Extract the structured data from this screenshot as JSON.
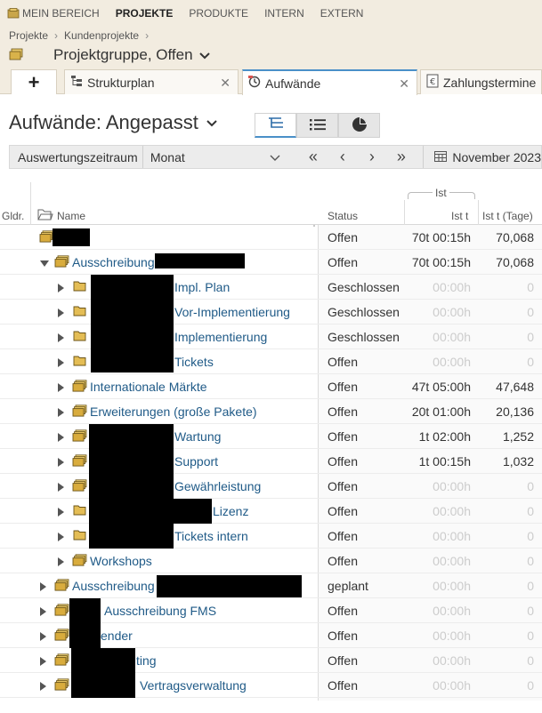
{
  "topnav": {
    "items": [
      {
        "label": "MEIN BEREICH",
        "active": false
      },
      {
        "label": "PROJEKTE",
        "active": true
      },
      {
        "label": "PRODUKTE",
        "active": false
      },
      {
        "label": "INTERN",
        "active": false
      },
      {
        "label": "EXTERN",
        "active": false
      }
    ]
  },
  "breadcrumb": [
    "Projekte",
    "Kundenprojekte"
  ],
  "project": {
    "title": "Projektgruppe, Offen"
  },
  "tabs": [
    {
      "label": "Strukturplan"
    },
    {
      "label": "Aufwände"
    },
    {
      "label": "Zahlungstermine"
    }
  ],
  "view": {
    "title": "Aufwände: Angepasst"
  },
  "filter": {
    "label": "Auswertungszeitraum",
    "select": "Monat",
    "period": "November 2023"
  },
  "table": {
    "headers": {
      "gldr": "Gldr.",
      "name": "Name",
      "status": "Status",
      "group": "Ist",
      "ist_t": "Ist t",
      "ist_tage": "Ist t (Tage)"
    },
    "rows": [
      {
        "name": "",
        "status": "Offen",
        "ist": "70t 00:15h",
        "tage": "70,068"
      },
      {
        "name": "Ausschreibung",
        "status": "Offen",
        "ist": "70t 00:15h",
        "tage": "70,068"
      },
      {
        "name": "Impl. Plan",
        "status": "Geschlossen",
        "ist": "00:00h",
        "tage": "0"
      },
      {
        "name": "Vor-Implementierung",
        "status": "Geschlossen",
        "ist": "00:00h",
        "tage": "0"
      },
      {
        "name": "Implementierung",
        "status": "Geschlossen",
        "ist": "00:00h",
        "tage": "0"
      },
      {
        "name": "Tickets",
        "status": "Offen",
        "ist": "00:00h",
        "tage": "0"
      },
      {
        "name": "Internationale Märkte",
        "status": "Offen",
        "ist": "47t 05:00h",
        "tage": "47,648"
      },
      {
        "name": "Erweiterungen (große Pakete)",
        "status": "Offen",
        "ist": "20t 01:00h",
        "tage": "20,136"
      },
      {
        "name": "Wartung",
        "status": "Offen",
        "ist": "1t 02:00h",
        "tage": "1,252"
      },
      {
        "name": "Support",
        "status": "Offen",
        "ist": "1t 00:15h",
        "tage": "1,032"
      },
      {
        "name": "Gewährleistung",
        "status": "Offen",
        "ist": "00:00h",
        "tage": "0"
      },
      {
        "name": "Lizenz",
        "status": "Offen",
        "ist": "00:00h",
        "tage": "0"
      },
      {
        "name": "Tickets intern",
        "status": "Offen",
        "ist": "00:00h",
        "tage": "0"
      },
      {
        "name": "Workshops",
        "status": "Offen",
        "ist": "00:00h",
        "tage": "0"
      },
      {
        "name": "Ausschreibung",
        "status": "geplant",
        "ist": "00:00h",
        "tage": "0"
      },
      {
        "name": "Ausschreibung FMS",
        "status": "Offen",
        "ist": "00:00h",
        "tage": "0"
      },
      {
        "name": "ender",
        "status": "Offen",
        "ist": "00:00h",
        "tage": "0"
      },
      {
        "name": "ting",
        "status": "Offen",
        "ist": "00:00h",
        "tage": "0"
      },
      {
        "name": "Vertragsverwaltung",
        "status": "Offen",
        "ist": "00:00h",
        "tage": "0"
      }
    ]
  }
}
